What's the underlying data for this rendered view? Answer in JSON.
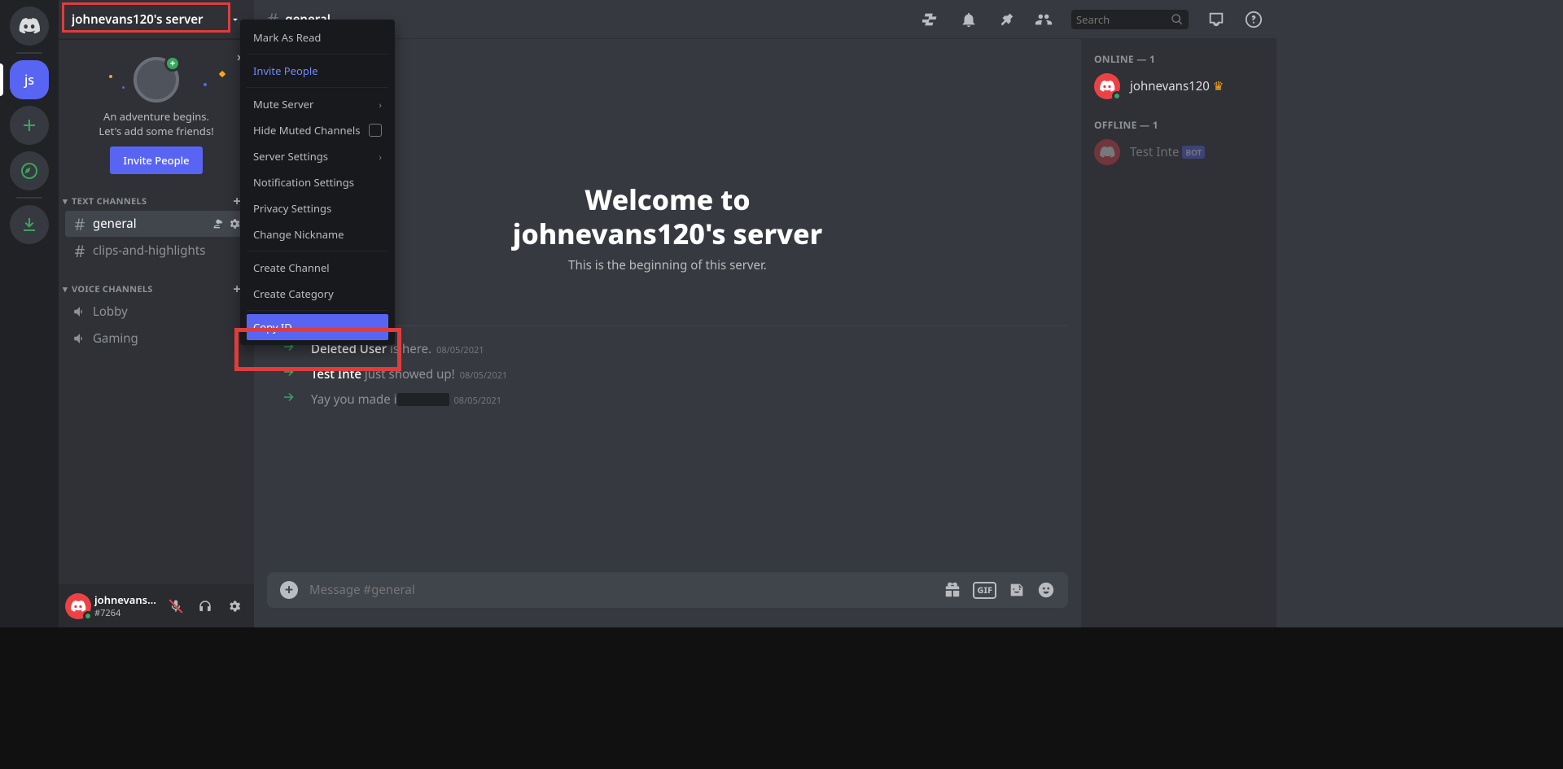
{
  "server_name": "johnevans120's server",
  "channel_header": "general",
  "servers_col": {
    "initials": "js"
  },
  "banner": {
    "line1": "An adventure begins.",
    "line2": "Let's add some friends!",
    "invite_btn": "Invite People"
  },
  "categories": {
    "text": "TEXT CHANNELS",
    "voice": "VOICE CHANNELS"
  },
  "channels": {
    "text": [
      "general",
      "clips-and-highlights"
    ],
    "voice": [
      "Lobby",
      "Gaming"
    ]
  },
  "dropdown": {
    "mark_read": "Mark As Read",
    "invite": "Invite People",
    "mute": "Mute Server",
    "hide_muted": "Hide Muted Channels",
    "server_settings": "Server Settings",
    "notif": "Notification Settings",
    "privacy": "Privacy Settings",
    "nickname": "Change Nickname",
    "create_channel": "Create Channel",
    "create_category": "Create Category",
    "copy_id": "Copy ID"
  },
  "welcome": {
    "title_top": "Welcome to",
    "title_server": "johnevans120's server",
    "subtitle": "This is the beginning of this server."
  },
  "sys_msgs": [
    {
      "pre": "Deleted User",
      "post": " is here.",
      "date": "08/05/2021",
      "blackout": false
    },
    {
      "pre": "Test Inte",
      "post": " just showed up!",
      "date": "08/05/2021",
      "blackout": false
    },
    {
      "pre": "",
      "post": "Yay you made i",
      "date": "08/05/2021",
      "blackout": true
    }
  ],
  "message_input_placeholder": "Message #general",
  "search_placeholder": "Search",
  "members": {
    "online_hdr": "ONLINE — 1",
    "offline_hdr": "OFFLINE — 1",
    "online": {
      "name": "johnevans120"
    },
    "offline": {
      "name": "Test Inte",
      "bot_label": "BOT"
    }
  },
  "me": {
    "name": "johnevans120",
    "tag": "#7264"
  },
  "gif_label": "GIF"
}
